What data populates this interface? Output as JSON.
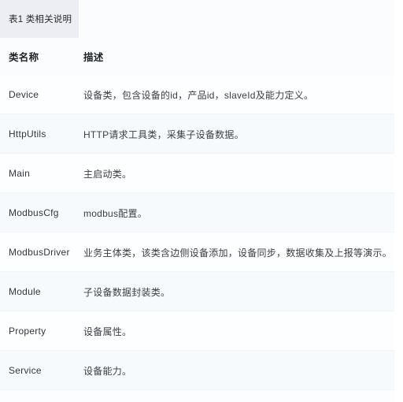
{
  "caption": {
    "label": "表1 类相关说明"
  },
  "table": {
    "headers": {
      "name": "类名称",
      "description": "描述"
    },
    "rows": [
      {
        "name": "Device",
        "description": "设备类，包含设备的id，产品id，slaveId及能力定义。"
      },
      {
        "name": "HttpUtils",
        "description": "HTTP请求工具类，采集子设备数据。"
      },
      {
        "name": "Main",
        "description": "主启动类。"
      },
      {
        "name": "ModbusCfg",
        "description": "modbus配置。"
      },
      {
        "name": "ModbusDriver",
        "description": "业务主体类，该类含边侧设备添加，设备同步，数据收集及上报等演示。"
      },
      {
        "name": "Module",
        "description": "子设备数据封装类。"
      },
      {
        "name": "Property",
        "description": "设备属性。"
      },
      {
        "name": "Service",
        "description": "设备能力。"
      }
    ]
  },
  "colors": {
    "caption_background": "#eceef3",
    "table_background": "#fbfdfe",
    "row_stripe": "#f6fafd",
    "text": "#3c4148",
    "header_text": "#1f2328"
  }
}
